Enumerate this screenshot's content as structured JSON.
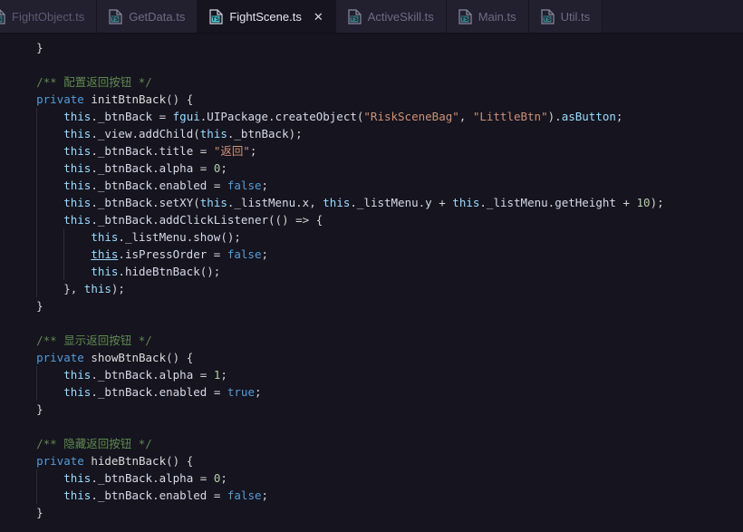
{
  "window": {
    "background": "#15141f",
    "tabbar_background": "#1d1b2a"
  },
  "tabbar": {
    "tabs": [
      {
        "label": "FightObject.ts",
        "icon": "typescript-file-icon",
        "active": false,
        "truncated": true,
        "closable": false
      },
      {
        "label": "GetData.ts",
        "icon": "typescript-file-icon",
        "active": false,
        "closable": false
      },
      {
        "label": "FightScene.ts",
        "icon": "typescript-file-icon",
        "active": true,
        "closable": true,
        "close_label": "✕"
      },
      {
        "label": "ActiveSkill.ts",
        "icon": "typescript-file-icon",
        "active": false,
        "closable": false
      },
      {
        "label": "Main.ts",
        "icon": "typescript-file-icon",
        "active": false,
        "closable": false
      },
      {
        "label": "Util.ts",
        "icon": "typescript-file-icon",
        "active": false,
        "closable": false
      }
    ]
  },
  "editor": {
    "language": "typescript",
    "colors": {
      "keyword": "#569cd6",
      "comment": "#5f8a4f",
      "string": "#ce9178",
      "number": "#b5cea8",
      "variable": "#9cdcfe",
      "plain": "#d4d4d4"
    },
    "lines": [
      {
        "indent": 1,
        "tokens": [
          {
            "t": "}",
            "c": "punc"
          }
        ]
      },
      {
        "indent": 0,
        "tokens": []
      },
      {
        "indent": 1,
        "tokens": [
          {
            "t": "/** 配置返回按钮 */",
            "c": "com"
          }
        ]
      },
      {
        "indent": 1,
        "tokens": [
          {
            "t": "private",
            "c": "kw"
          },
          {
            "t": " ",
            "c": "punc"
          },
          {
            "t": "initBtnBack",
            "c": "fn"
          },
          {
            "t": "() {",
            "c": "punc"
          }
        ]
      },
      {
        "indent": 2,
        "tokens": [
          {
            "t": "this",
            "c": "this"
          },
          {
            "t": "._btnBack ",
            "c": "prop"
          },
          {
            "t": "= ",
            "c": "op"
          },
          {
            "t": "fgui",
            "c": "this"
          },
          {
            "t": ".",
            "c": "punc"
          },
          {
            "t": "UIPackage",
            "c": "prop"
          },
          {
            "t": ".",
            "c": "punc"
          },
          {
            "t": "createObject",
            "c": "prop"
          },
          {
            "t": "(",
            "c": "punc"
          },
          {
            "t": "\"RiskSceneBag\"",
            "c": "str"
          },
          {
            "t": ", ",
            "c": "punc"
          },
          {
            "t": "\"LittleBtn\"",
            "c": "str"
          },
          {
            "t": ").",
            "c": "punc"
          },
          {
            "t": "asButton",
            "c": "this"
          },
          {
            "t": ";",
            "c": "punc"
          }
        ]
      },
      {
        "indent": 2,
        "tokens": [
          {
            "t": "this",
            "c": "this"
          },
          {
            "t": "._view",
            "c": "prop"
          },
          {
            "t": ".",
            "c": "punc"
          },
          {
            "t": "addChild",
            "c": "prop"
          },
          {
            "t": "(",
            "c": "punc"
          },
          {
            "t": "this",
            "c": "this"
          },
          {
            "t": "._btnBack",
            "c": "prop"
          },
          {
            "t": ");",
            "c": "punc"
          }
        ]
      },
      {
        "indent": 2,
        "tokens": [
          {
            "t": "this",
            "c": "this"
          },
          {
            "t": "._btnBack",
            "c": "prop"
          },
          {
            "t": ".",
            "c": "punc"
          },
          {
            "t": "title ",
            "c": "prop"
          },
          {
            "t": "= ",
            "c": "op"
          },
          {
            "t": "\"返回\"",
            "c": "str"
          },
          {
            "t": ";",
            "c": "punc"
          }
        ]
      },
      {
        "indent": 2,
        "tokens": [
          {
            "t": "this",
            "c": "this"
          },
          {
            "t": "._btnBack",
            "c": "prop"
          },
          {
            "t": ".",
            "c": "punc"
          },
          {
            "t": "alpha ",
            "c": "prop"
          },
          {
            "t": "= ",
            "c": "op"
          },
          {
            "t": "0",
            "c": "num"
          },
          {
            "t": ";",
            "c": "punc"
          }
        ]
      },
      {
        "indent": 2,
        "tokens": [
          {
            "t": "this",
            "c": "this"
          },
          {
            "t": "._btnBack",
            "c": "prop"
          },
          {
            "t": ".",
            "c": "punc"
          },
          {
            "t": "enabled ",
            "c": "prop"
          },
          {
            "t": "= ",
            "c": "op"
          },
          {
            "t": "false",
            "c": "kw"
          },
          {
            "t": ";",
            "c": "punc"
          }
        ]
      },
      {
        "indent": 2,
        "tokens": [
          {
            "t": "this",
            "c": "this"
          },
          {
            "t": "._btnBack",
            "c": "prop"
          },
          {
            "t": ".",
            "c": "punc"
          },
          {
            "t": "setXY",
            "c": "prop"
          },
          {
            "t": "(",
            "c": "punc"
          },
          {
            "t": "this",
            "c": "this"
          },
          {
            "t": "._listMenu",
            "c": "prop"
          },
          {
            "t": ".",
            "c": "punc"
          },
          {
            "t": "x",
            "c": "prop"
          },
          {
            "t": ", ",
            "c": "punc"
          },
          {
            "t": "this",
            "c": "this"
          },
          {
            "t": "._listMenu",
            "c": "prop"
          },
          {
            "t": ".",
            "c": "punc"
          },
          {
            "t": "y ",
            "c": "prop"
          },
          {
            "t": "+ ",
            "c": "op"
          },
          {
            "t": "this",
            "c": "this"
          },
          {
            "t": "._listMenu",
            "c": "prop"
          },
          {
            "t": ".",
            "c": "punc"
          },
          {
            "t": "getHeight ",
            "c": "prop"
          },
          {
            "t": "+ ",
            "c": "op"
          },
          {
            "t": "10",
            "c": "num"
          },
          {
            "t": ");",
            "c": "punc"
          }
        ]
      },
      {
        "indent": 2,
        "tokens": [
          {
            "t": "this",
            "c": "this"
          },
          {
            "t": "._btnBack",
            "c": "prop"
          },
          {
            "t": ".",
            "c": "punc"
          },
          {
            "t": "addClickListener",
            "c": "prop"
          },
          {
            "t": "(() ",
            "c": "punc"
          },
          {
            "t": "=> ",
            "c": "op"
          },
          {
            "t": "{",
            "c": "punc"
          }
        ]
      },
      {
        "indent": 3,
        "tokens": [
          {
            "t": "this",
            "c": "this"
          },
          {
            "t": "._listMenu",
            "c": "prop"
          },
          {
            "t": ".",
            "c": "punc"
          },
          {
            "t": "show",
            "c": "prop"
          },
          {
            "t": "();",
            "c": "punc"
          }
        ]
      },
      {
        "indent": 3,
        "tokens": [
          {
            "t": "this",
            "c": "this ul"
          },
          {
            "t": ".",
            "c": "punc"
          },
          {
            "t": "isPressOrder ",
            "c": "prop"
          },
          {
            "t": "= ",
            "c": "op"
          },
          {
            "t": "false",
            "c": "kw"
          },
          {
            "t": ";",
            "c": "punc"
          }
        ]
      },
      {
        "indent": 3,
        "tokens": [
          {
            "t": "this",
            "c": "this"
          },
          {
            "t": ".",
            "c": "punc"
          },
          {
            "t": "hideBtnBack",
            "c": "prop"
          },
          {
            "t": "();",
            "c": "punc"
          }
        ]
      },
      {
        "indent": 2,
        "tokens": [
          {
            "t": "}, ",
            "c": "punc"
          },
          {
            "t": "this",
            "c": "this"
          },
          {
            "t": ");",
            "c": "punc"
          }
        ]
      },
      {
        "indent": 1,
        "tokens": [
          {
            "t": "}",
            "c": "punc"
          }
        ]
      },
      {
        "indent": 0,
        "tokens": []
      },
      {
        "indent": 1,
        "tokens": [
          {
            "t": "/** 显示返回按钮 */",
            "c": "com"
          }
        ]
      },
      {
        "indent": 1,
        "tokens": [
          {
            "t": "private",
            "c": "kw"
          },
          {
            "t": " ",
            "c": "punc"
          },
          {
            "t": "showBtnBack",
            "c": "fn"
          },
          {
            "t": "() {",
            "c": "punc"
          }
        ]
      },
      {
        "indent": 2,
        "tokens": [
          {
            "t": "this",
            "c": "this"
          },
          {
            "t": "._btnBack",
            "c": "prop"
          },
          {
            "t": ".",
            "c": "punc"
          },
          {
            "t": "alpha ",
            "c": "prop"
          },
          {
            "t": "= ",
            "c": "op"
          },
          {
            "t": "1",
            "c": "num"
          },
          {
            "t": ";",
            "c": "punc"
          }
        ]
      },
      {
        "indent": 2,
        "tokens": [
          {
            "t": "this",
            "c": "this"
          },
          {
            "t": "._btnBack",
            "c": "prop"
          },
          {
            "t": ".",
            "c": "punc"
          },
          {
            "t": "enabled ",
            "c": "prop"
          },
          {
            "t": "= ",
            "c": "op"
          },
          {
            "t": "true",
            "c": "kw"
          },
          {
            "t": ";",
            "c": "punc"
          }
        ]
      },
      {
        "indent": 1,
        "tokens": [
          {
            "t": "}",
            "c": "punc"
          }
        ]
      },
      {
        "indent": 0,
        "tokens": []
      },
      {
        "indent": 1,
        "tokens": [
          {
            "t": "/** 隐藏返回按钮 */",
            "c": "com"
          }
        ]
      },
      {
        "indent": 1,
        "tokens": [
          {
            "t": "private",
            "c": "kw"
          },
          {
            "t": " ",
            "c": "punc"
          },
          {
            "t": "hideBtnBack",
            "c": "fn"
          },
          {
            "t": "() {",
            "c": "punc"
          }
        ]
      },
      {
        "indent": 2,
        "tokens": [
          {
            "t": "this",
            "c": "this"
          },
          {
            "t": "._btnBack",
            "c": "prop"
          },
          {
            "t": ".",
            "c": "punc"
          },
          {
            "t": "alpha ",
            "c": "prop"
          },
          {
            "t": "= ",
            "c": "op"
          },
          {
            "t": "0",
            "c": "num"
          },
          {
            "t": ";",
            "c": "punc"
          }
        ]
      },
      {
        "indent": 2,
        "tokens": [
          {
            "t": "this",
            "c": "this"
          },
          {
            "t": "._btnBack",
            "c": "prop"
          },
          {
            "t": ".",
            "c": "punc"
          },
          {
            "t": "enabled ",
            "c": "prop"
          },
          {
            "t": "= ",
            "c": "op"
          },
          {
            "t": "false",
            "c": "kw"
          },
          {
            "t": ";",
            "c": "punc"
          }
        ]
      },
      {
        "indent": 1,
        "tokens": [
          {
            "t": "}",
            "c": "punc"
          }
        ]
      }
    ]
  }
}
